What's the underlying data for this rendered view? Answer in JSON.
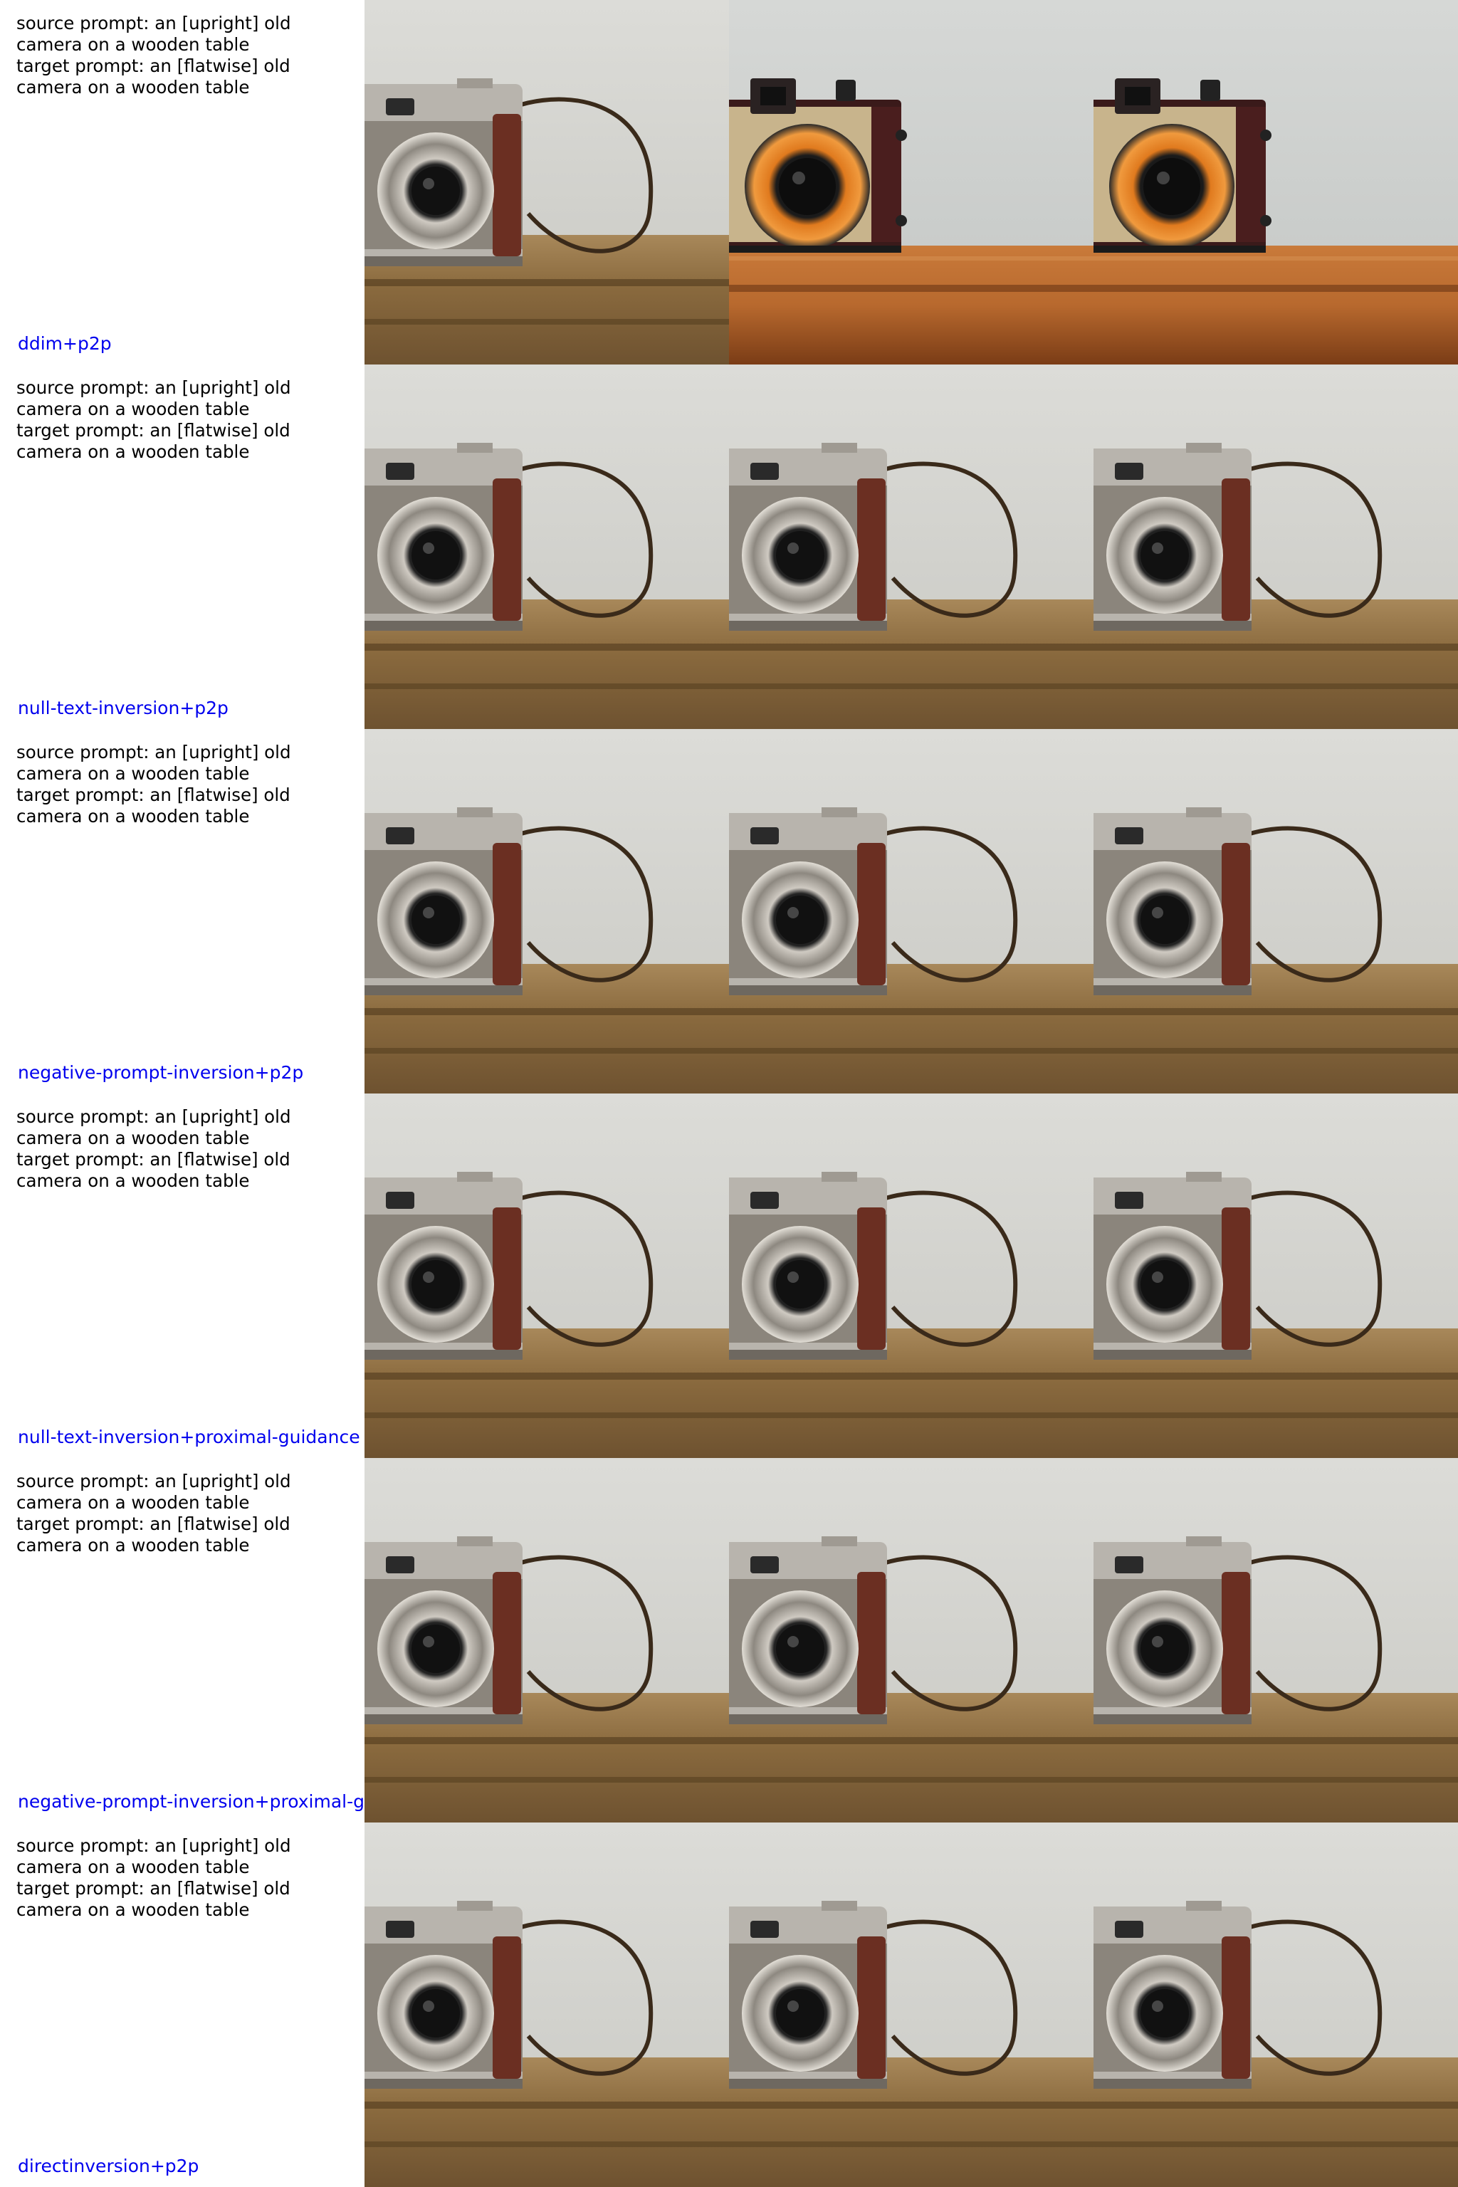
{
  "rows": [
    {
      "prompt_lines": [
        "source prompt: an [upright] old",
        "camera on a wooden table",
        "target prompt: an [flatwise] old",
        "camera on a wooden table"
      ],
      "method": "ddim+p2p",
      "images": [
        {
          "style": "rangefinder",
          "icon": "old-camera-photo"
        },
        {
          "style": "boxcam",
          "icon": "box-camera-photo"
        },
        {
          "style": "boxcam",
          "icon": "box-camera-photo"
        }
      ]
    },
    {
      "prompt_lines": [
        "source prompt: an [upright] old",
        "camera on a wooden table",
        "target prompt: an [flatwise] old",
        "camera on a wooden table"
      ],
      "method": "null-text-inversion+p2p",
      "images": [
        {
          "style": "rangefinder",
          "icon": "old-camera-photo"
        },
        {
          "style": "rangefinder",
          "icon": "old-camera-photo"
        },
        {
          "style": "rangefinder",
          "icon": "old-camera-photo"
        }
      ]
    },
    {
      "prompt_lines": [
        "source prompt: an [upright] old",
        "camera on a wooden table",
        "target prompt: an [flatwise] old",
        "camera on a wooden table"
      ],
      "method": "negative-prompt-inversion+p2p",
      "images": [
        {
          "style": "rangefinder",
          "icon": "old-camera-photo"
        },
        {
          "style": "rangefinder",
          "icon": "old-camera-photo"
        },
        {
          "style": "rangefinder",
          "icon": "old-camera-photo"
        }
      ]
    },
    {
      "prompt_lines": [
        "source prompt: an [upright] old",
        "camera on a wooden table",
        "target prompt: an [flatwise] old",
        "camera on a wooden table"
      ],
      "method": "null-text-inversion+proximal-guidance",
      "images": [
        {
          "style": "rangefinder",
          "icon": "old-camera-photo"
        },
        {
          "style": "rangefinder",
          "icon": "old-camera-photo"
        },
        {
          "style": "rangefinder",
          "icon": "old-camera-photo"
        }
      ]
    },
    {
      "prompt_lines": [
        "source prompt: an [upright] old",
        "camera on a wooden table",
        "target prompt: an [flatwise] old",
        "camera on a wooden table"
      ],
      "method": "negative-prompt-inversion+proximal-g",
      "images": [
        {
          "style": "rangefinder",
          "icon": "old-camera-photo"
        },
        {
          "style": "rangefinder",
          "icon": "old-camera-photo"
        },
        {
          "style": "rangefinder",
          "icon": "old-camera-photo"
        }
      ]
    },
    {
      "prompt_lines": [
        "source prompt: an [upright] old",
        "camera on a wooden table",
        "target prompt: an [flatwise] old",
        "camera on a wooden table"
      ],
      "method": "directinversion+p2p",
      "images": [
        {
          "style": "rangefinder",
          "icon": "old-camera-photo"
        },
        {
          "style": "rangefinder",
          "icon": "old-camera-photo"
        },
        {
          "style": "rangefinder",
          "icon": "old-camera-photo"
        }
      ]
    }
  ],
  "colors": {
    "wall": "#d9d9d4",
    "table": "#8a6a3e",
    "table_warm": "#b8692e",
    "leather": "#6b2f22",
    "chrome": "#b8b4ad",
    "method_text": "#0000ee"
  }
}
